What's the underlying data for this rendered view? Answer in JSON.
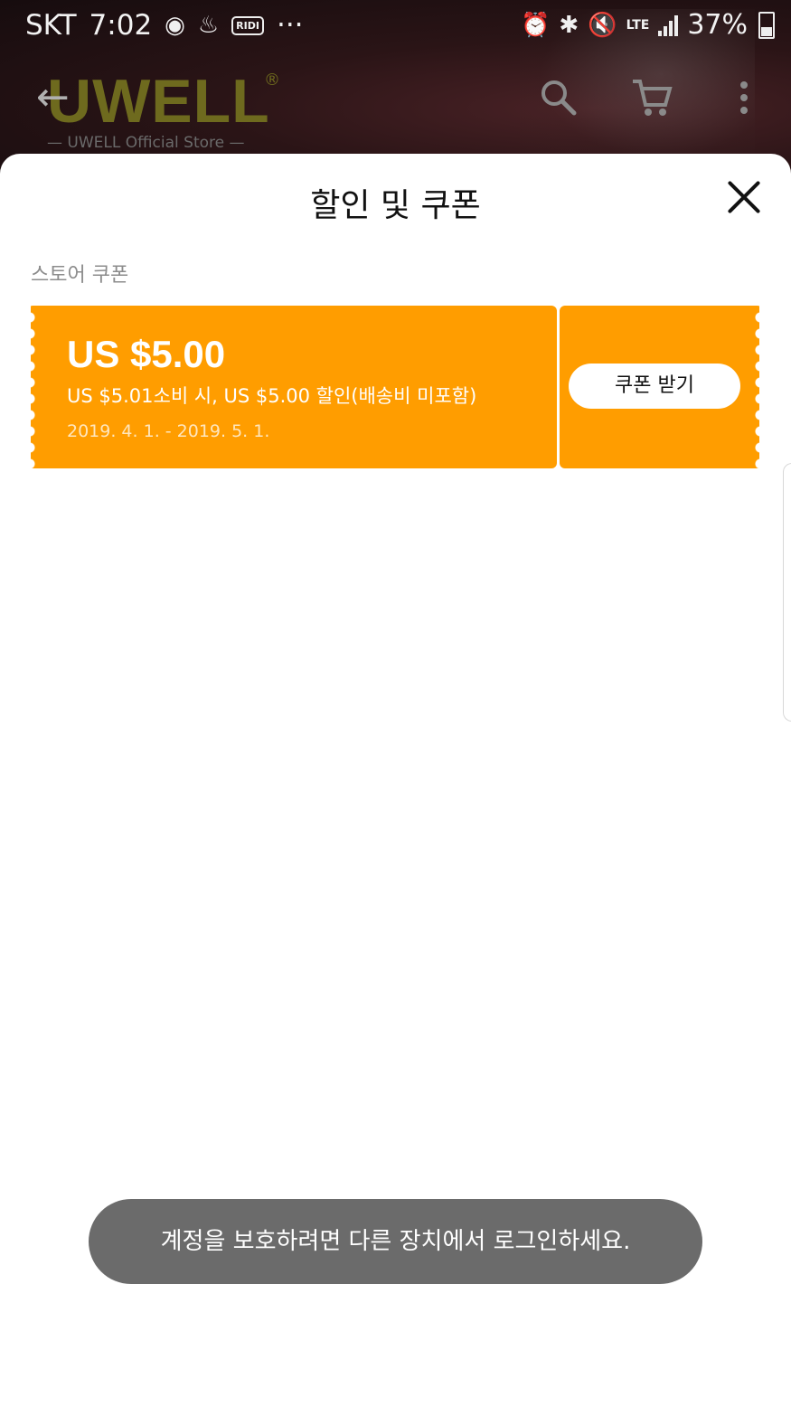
{
  "status_bar": {
    "carrier": "SKT",
    "time": "7:02",
    "app_icons": [
      "circle-dot-icon",
      "download-cloud-icon",
      "ridi-icon",
      "more-notifications-icon"
    ],
    "ridi_label": "RIDI",
    "more": "···",
    "network": "LTE",
    "battery": "37%"
  },
  "app_header": {
    "logo_text": "UWELL",
    "logo_reg": "®",
    "store_name": "— UWELL Official Store —"
  },
  "sheet": {
    "title": "할인 및 쿠폰",
    "section_label": "스토어 쿠폰",
    "coupon": {
      "amount": "US $5.00",
      "condition": "US $5.01소비 시, US $5.00 할인(배송비 미포함)",
      "dates": "2019. 4. 1. - 2019. 5. 1.",
      "claim_label": "쿠폰 받기",
      "color": "#ff9d00"
    }
  },
  "toast": {
    "message": "계정을 보호하려면 다른 장치에서 로그인하세요."
  }
}
